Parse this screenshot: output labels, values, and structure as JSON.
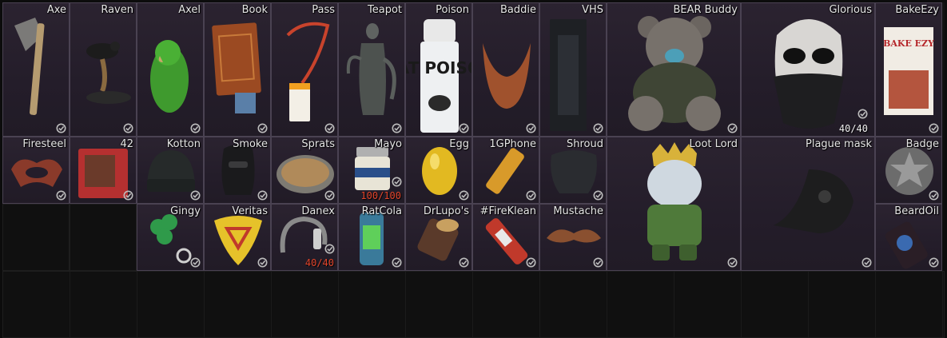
{
  "inventory": {
    "items": [
      {
        "name": "Axe"
      },
      {
        "name": "Raven"
      },
      {
        "name": "Axel"
      },
      {
        "name": "Book"
      },
      {
        "name": "Pass"
      },
      {
        "name": "Teapot"
      },
      {
        "name": "Poison"
      },
      {
        "name": "Baddie"
      },
      {
        "name": "VHS"
      },
      {
        "name": "BEAR Buddy"
      },
      {
        "name": "Glorious",
        "count": "40/40"
      },
      {
        "name": "BakeEzy"
      },
      {
        "name": "Firesteel"
      },
      {
        "name": "42"
      },
      {
        "name": "Kotton"
      },
      {
        "name": "Smoke"
      },
      {
        "name": "Sprats"
      },
      {
        "name": "Mayo",
        "count": "100/100"
      },
      {
        "name": "Egg"
      },
      {
        "name": "1GPhone"
      },
      {
        "name": "Shroud"
      },
      {
        "name": "Loot Lord"
      },
      {
        "name": "Plague mask"
      },
      {
        "name": "Badge"
      },
      {
        "name": "Gingy"
      },
      {
        "name": "Veritas"
      },
      {
        "name": "Danex",
        "count": "40/40"
      },
      {
        "name": "RatCola"
      },
      {
        "name": "DrLupo's"
      },
      {
        "name": "#FireKlean"
      },
      {
        "name": "Mustache"
      },
      {
        "name": "BeardOil"
      }
    ],
    "item_art_text": {
      "poison": "RAT POISON",
      "bakeezy": "BAKE EZY"
    }
  }
}
